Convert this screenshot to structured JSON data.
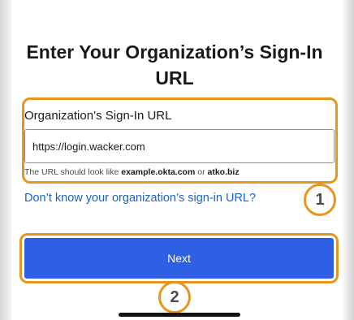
{
  "page": {
    "title": "Enter Your Organization’s Sign-In URL"
  },
  "url_field": {
    "label": "Organization’s Sign-In URL",
    "value": "https://login.wacker.com",
    "hint_prefix": "The URL should look like ",
    "hint_example_1": "example.okta.com",
    "hint_or": " or ",
    "hint_example_2": "atko.biz"
  },
  "help_link": {
    "label": "Don’t know your organization’s sign-in URL?"
  },
  "next_button": {
    "label": "Next"
  },
  "callouts": {
    "step_1": "1",
    "step_2": "2"
  },
  "colors": {
    "accent_highlight": "#e6961f",
    "primary_button": "#2f5fe3",
    "link": "#1c62c6"
  }
}
